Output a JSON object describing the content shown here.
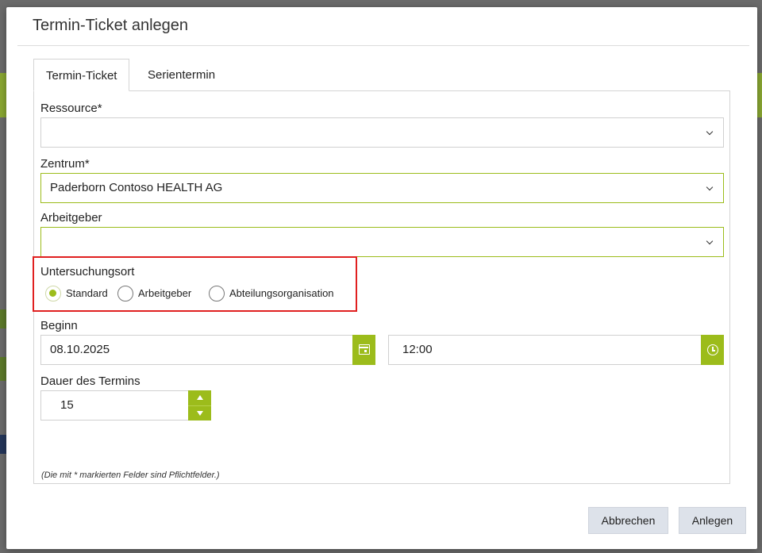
{
  "colors": {
    "accent": "#9cbc1b",
    "highlight_border": "#e02020",
    "button_bg": "#dde2ea"
  },
  "dialog": {
    "title": "Termin-Ticket anlegen",
    "tabs": [
      {
        "label": "Termin-Ticket",
        "active": true
      },
      {
        "label": "Serientermin",
        "active": false
      }
    ],
    "form": {
      "ressource": {
        "label": "Ressource*",
        "value": ""
      },
      "zentrum": {
        "label": "Zentrum*",
        "value": "Paderborn Contoso HEALTH AG"
      },
      "arbeitgeber": {
        "label": "Arbeitgeber",
        "value": ""
      },
      "untersuchungsort": {
        "label": "Untersuchungsort",
        "options": [
          {
            "label": "Standard",
            "checked": true
          },
          {
            "label": "Arbeitgeber",
            "checked": false
          },
          {
            "label": "Abteilungsorganisation",
            "checked": false
          }
        ]
      },
      "beginn": {
        "label": "Beginn",
        "date": "08.10.2025",
        "time": "12:00",
        "date_icon": "calendar-icon",
        "time_icon": "clock-icon"
      },
      "dauer": {
        "label": "Dauer des Termins",
        "value": "15"
      },
      "required_note": "(Die mit * markierten Felder sind Pflichtfelder.)"
    },
    "buttons": {
      "cancel": "Abbrechen",
      "create": "Anlegen"
    }
  }
}
